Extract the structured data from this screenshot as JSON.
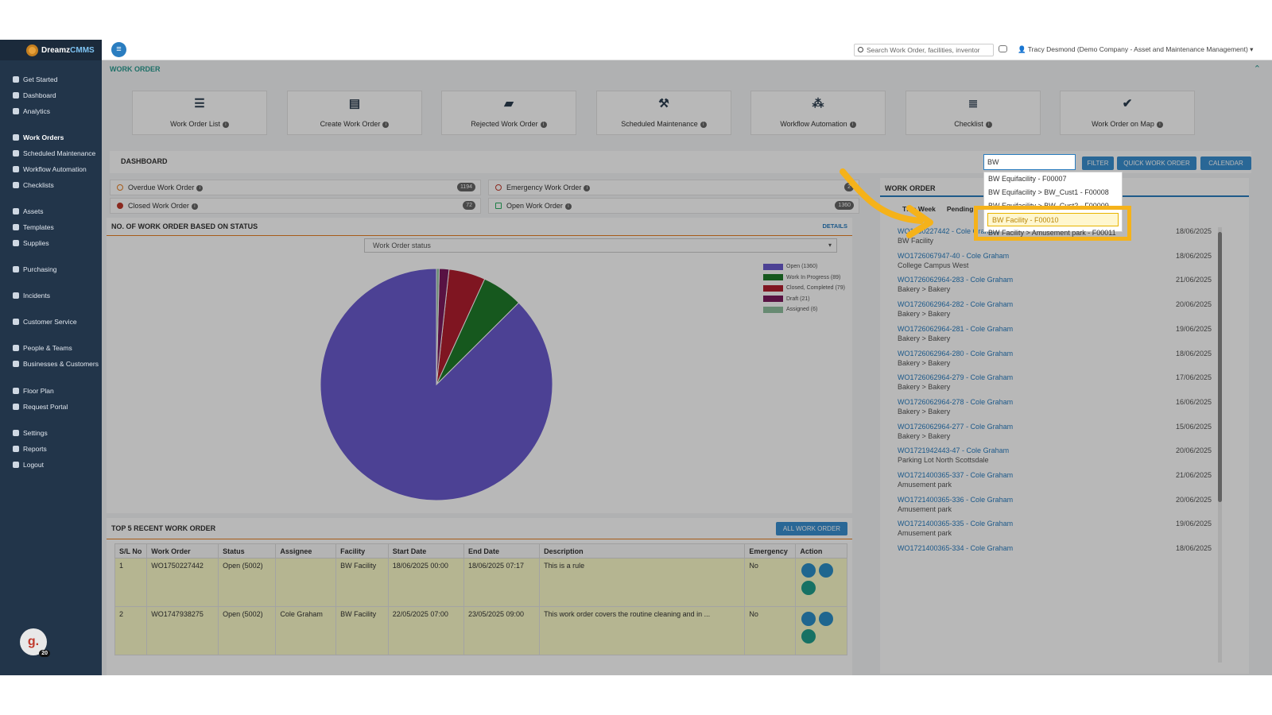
{
  "app": {
    "brand_a": "Dreamz",
    "brand_b": "CMMS",
    "avatar_letter": "g.",
    "avatar_count": "20"
  },
  "sidebar": {
    "items": [
      {
        "label": "Get Started"
      },
      {
        "label": "Dashboard"
      },
      {
        "label": "Analytics"
      },
      {
        "label": "Work Orders"
      },
      {
        "label": "Scheduled Maintenance"
      },
      {
        "label": "Workflow Automation"
      },
      {
        "label": "Checklists"
      },
      {
        "label": "Assets"
      },
      {
        "label": "Templates"
      },
      {
        "label": "Supplies"
      },
      {
        "label": "Purchasing"
      },
      {
        "label": "Incidents"
      },
      {
        "label": "Customer Service"
      },
      {
        "label": "People & Teams"
      },
      {
        "label": "Businesses & Customers"
      },
      {
        "label": "Floor Plan"
      },
      {
        "label": "Request Portal"
      },
      {
        "label": "Settings"
      },
      {
        "label": "Reports"
      },
      {
        "label": "Logout"
      }
    ]
  },
  "topbar": {
    "search_placeholder": "Search Work Order, facilities, inventor",
    "user": "Tracy Desmond (Demo Company - Asset and Maintenance Management)"
  },
  "section_title": "WORK ORDER",
  "tiles": [
    {
      "label": "Work Order List",
      "icon": "list-icon"
    },
    {
      "label": "Create Work Order",
      "icon": "file-icon"
    },
    {
      "label": "Rejected Work Order",
      "icon": "rejected-icon"
    },
    {
      "label": "Scheduled Maintenance",
      "icon": "tools-icon"
    },
    {
      "label": "Workflow Automation",
      "icon": "workflow-icon"
    },
    {
      "label": "Checklist",
      "icon": "checklist-icon"
    },
    {
      "label": "Work Order on Map",
      "icon": "map-check-icon"
    }
  ],
  "dashboard": {
    "title": "DASHBOARD",
    "filter_value": "BW",
    "filter_btn": "FILTER",
    "quick_btn": "QUICK WORK ORDER",
    "calendar_btn": "CALENDAR"
  },
  "stats": {
    "overdue": {
      "label": "Overdue Work Order",
      "count": "1194"
    },
    "emergency": {
      "label": "Emergency Work Order",
      "count": "2"
    },
    "closed": {
      "label": "Closed Work Order",
      "count": "72"
    },
    "open": {
      "label": "Open Work Order",
      "count": "1360"
    }
  },
  "status_chart": {
    "title": "NO. OF WORK ORDER BASED ON STATUS",
    "details": "DETAILS",
    "select": "Work Order status"
  },
  "chart_data": {
    "type": "pie",
    "categories": [
      "Open (1360)",
      "Work In Progress (89)",
      "Closed, Completed (79)",
      "Draft (21)",
      "Assigned (6)"
    ],
    "values": [
      1360,
      89,
      79,
      21,
      6
    ],
    "colors": [
      "#6a5acd",
      "#1f7a2a",
      "#b01e2e",
      "#7a1a5e",
      "#8fbf9f"
    ]
  },
  "dropdown": {
    "items": [
      "BW Equifacility - F00007",
      "BW Equifacility > BW_Cust1 - F00008",
      "BW Equifacility > BW_Cust2 - F00009",
      "BW Facility - F00010",
      "BW Facility > Amusement park - F00011"
    ]
  },
  "wo_panel": {
    "title": "WORK ORDER",
    "tabs": [
      "This Week",
      "Pending"
    ],
    "rows": [
      {
        "id": "WO1750227442 - Cole Graham",
        "site": "BW Facility",
        "date": "18/06/2025"
      },
      {
        "id": "WO1726067947-40 - Cole Graham",
        "site": "College Campus West",
        "date": "18/06/2025"
      },
      {
        "id": "WO1726062964-283 - Cole Graham",
        "site": "Bakery > Bakery",
        "date": "21/06/2025"
      },
      {
        "id": "WO1726062964-282 - Cole Graham",
        "site": "Bakery > Bakery",
        "date": "20/06/2025"
      },
      {
        "id": "WO1726062964-281 - Cole Graham",
        "site": "Bakery > Bakery",
        "date": "19/06/2025"
      },
      {
        "id": "WO1726062964-280 - Cole Graham",
        "site": "Bakery > Bakery",
        "date": "18/06/2025"
      },
      {
        "id": "WO1726062964-279 - Cole Graham",
        "site": "Bakery > Bakery",
        "date": "17/06/2025"
      },
      {
        "id": "WO1726062964-278 - Cole Graham",
        "site": "Bakery > Bakery",
        "date": "16/06/2025"
      },
      {
        "id": "WO1726062964-277 - Cole Graham",
        "site": "Bakery > Bakery",
        "date": "15/06/2025"
      },
      {
        "id": "WO1721942443-47 - Cole Graham",
        "site": "Parking Lot North Scottsdale",
        "date": "20/06/2025"
      },
      {
        "id": "WO1721400365-337 - Cole Graham",
        "site": "Amusement park",
        "date": "21/06/2025"
      },
      {
        "id": "WO1721400365-336 - Cole Graham",
        "site": "Amusement park",
        "date": "20/06/2025"
      },
      {
        "id": "WO1721400365-335 - Cole Graham",
        "site": "Amusement park",
        "date": "19/06/2025"
      },
      {
        "id": "WO1721400365-334 - Cole Graham",
        "site": "",
        "date": "18/06/2025"
      }
    ]
  },
  "top5": {
    "title": "TOP 5 RECENT WORK ORDER",
    "all_btn": "ALL WORK ORDER",
    "headers": [
      "S/L No",
      "Work Order",
      "Status",
      "Assignee",
      "Facility",
      "Start Date",
      "End Date",
      "Description",
      "Emergency",
      "Action"
    ],
    "rows": [
      [
        "1",
        "WO1750227442",
        "Open (5002)",
        "",
        "BW Facility",
        "18/06/2025 00:00",
        "18/06/2025 07:17",
        "This is a rule",
        "No"
      ],
      [
        "2",
        "WO1747938275",
        "Open (5002)",
        "Cole Graham",
        "BW Facility",
        "22/05/2025 07:00",
        "23/05/2025 09:00",
        "This work order covers the routine cleaning and in ...",
        "No"
      ]
    ]
  }
}
